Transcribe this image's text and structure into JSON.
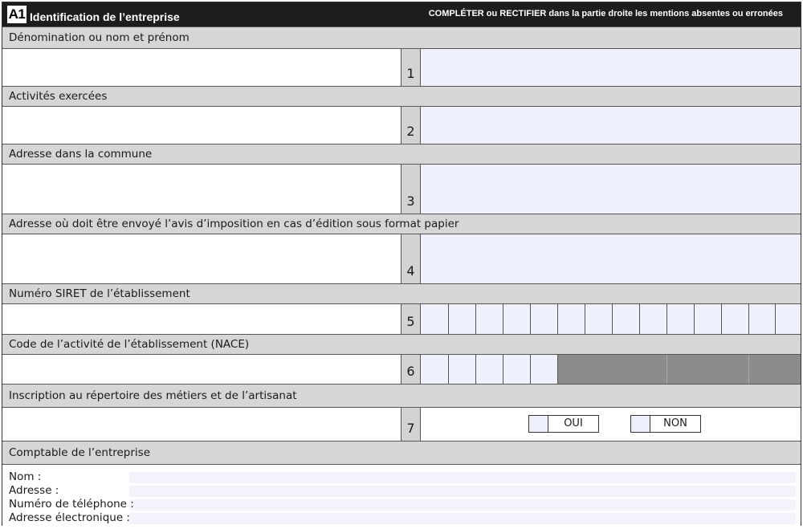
{
  "header": {
    "badge": "A1",
    "title": "Identification de l’entreprise",
    "instruction": "COMPLÉTER ou RECTIFIER dans la partie droite les mentions absentes ou erronées"
  },
  "sections": [
    {
      "label": "Dénomination ou nom et prénom",
      "number": "1"
    },
    {
      "label": "Activités exercées",
      "number": "2"
    },
    {
      "label": "Adresse dans la commune",
      "number": "3"
    },
    {
      "label": "Adresse où doit être envoyé l’avis d’imposition en cas d’édition sous format papier",
      "number": "4"
    },
    {
      "label": "Numéro SIRET de l’établissement",
      "number": "5"
    },
    {
      "label": "Code de l’activité de l’établissement (NACE)",
      "number": "6"
    },
    {
      "label": "Inscription au répertoire des métiers et de l’artisanat",
      "number": "7"
    }
  ],
  "artisanat_options": {
    "oui": "OUI",
    "non": "NON"
  },
  "comptable": {
    "label": "Comptable de l’entreprise",
    "nom": "Nom :",
    "adresse": "Adresse :",
    "telephone": "Numéro de téléphone :",
    "email": "Adresse électronique :"
  },
  "colors": {
    "header_bg": "#1d1d1d",
    "band_bg": "#d6d6d6",
    "input_bg": "#eef0fb",
    "disabled_bg": "#8c8c8c"
  }
}
